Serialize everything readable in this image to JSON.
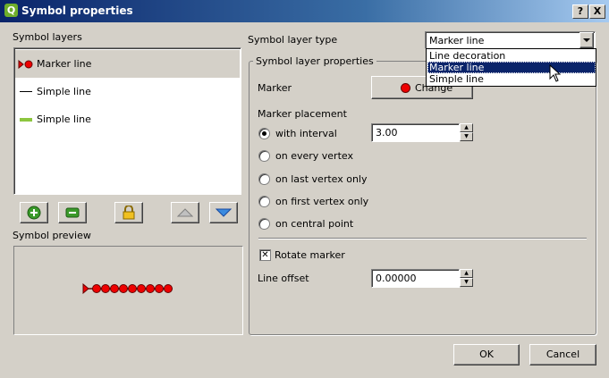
{
  "window": {
    "title": "Symbol properties",
    "help_button": "?",
    "close_button": "X"
  },
  "left": {
    "symbol_layers_label": "Symbol layers",
    "layers": [
      {
        "label": "Marker line",
        "icon": "marker-line-icon",
        "selected": true
      },
      {
        "label": "Simple line",
        "icon": "simple-line-black-icon",
        "color": "#000000"
      },
      {
        "label": "Simple line",
        "icon": "simple-line-green-icon",
        "color": "#8dc63f"
      }
    ],
    "buttons": [
      "add-layer",
      "remove-layer",
      "lock-layer",
      "move-up",
      "move-down"
    ],
    "symbol_preview_label": "Symbol preview",
    "preview_marker_count": 9
  },
  "right": {
    "symbol_layer_type_label": "Symbol layer type",
    "symbol_layer_type_value": "Marker line",
    "dropdown_options": [
      "Line decoration",
      "Marker line",
      "Simple line"
    ],
    "dropdown_selected_index": 1,
    "group_title": "Symbol layer properties",
    "marker_label": "Marker",
    "change_button": "Change",
    "marker_placement_label": "Marker placement",
    "placement_options": [
      {
        "label": "with interval",
        "checked": true
      },
      {
        "label": "on every vertex",
        "checked": false
      },
      {
        "label": "on last vertex only",
        "checked": false
      },
      {
        "label": "on first vertex only",
        "checked": false
      },
      {
        "label": "on central point",
        "checked": false
      }
    ],
    "interval_value": "3.00",
    "rotate_marker_label": "Rotate marker",
    "rotate_marker_checked": true,
    "line_offset_label": "Line offset",
    "line_offset_value": "0.00000"
  },
  "footer": {
    "ok": "OK",
    "cancel": "Cancel"
  },
  "colors": {
    "titlebar": "#0a246a",
    "selection": "#0a246a",
    "marker": "#e00000"
  }
}
